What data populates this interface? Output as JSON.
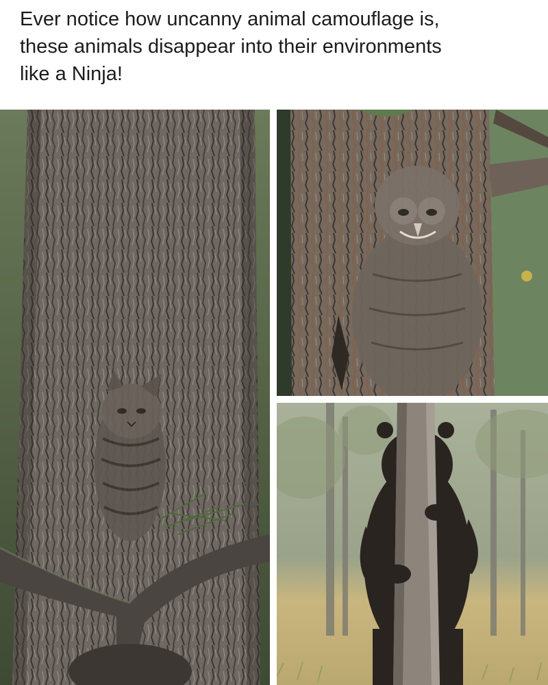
{
  "caption": {
    "line1": "Ever notice how uncanny animal camouflage is,",
    "line2": "these animals disappear into their environments",
    "line3": "like a Ninja!"
  },
  "photos": [
    {
      "subject": "cat camouflaged against tree trunk"
    },
    {
      "subject": "owl camouflaged against tree trunk"
    },
    {
      "subject": "bear hiding behind thin tree"
    }
  ],
  "colors": {
    "background": "#ffffff",
    "text": "#1c1c1c",
    "bark": "#6e6560",
    "bark_dark": "#3e3833",
    "forest": "#5b6b4a",
    "bear": "#2a2420",
    "grass": "#c8b57f"
  }
}
